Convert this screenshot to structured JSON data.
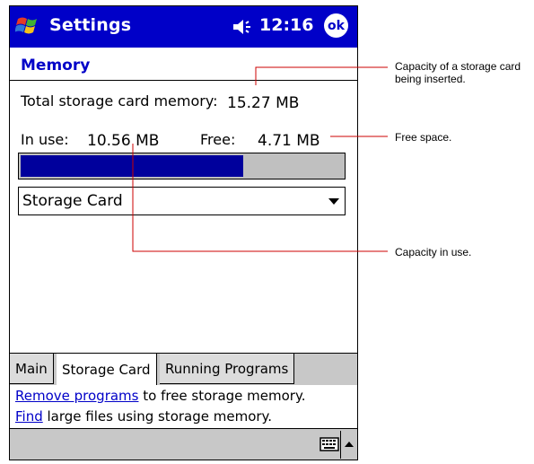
{
  "titlebar": {
    "app_title": "Settings",
    "time": "12:16",
    "ok_label": "ok",
    "accent_color": "#0000c8"
  },
  "page": {
    "title": "Memory"
  },
  "memory": {
    "total_label": "Total storage card memory:",
    "total_value": "15.27 MB",
    "in_use_label": "In use:",
    "in_use_value": "10.56 MB",
    "free_label": "Free:",
    "free_value": "4.71 MB",
    "usage_fraction": 0.69,
    "bar_color": "#00009c"
  },
  "storage_select": {
    "selected": "Storage Card"
  },
  "tabs": [
    {
      "label": "Main"
    },
    {
      "label": "Storage Card"
    },
    {
      "label": "Running Programs"
    }
  ],
  "links": {
    "line1_link": "Remove programs",
    "line1_rest": " to free storage memory.",
    "line2_link": "Find",
    "line2_rest": " large files using storage memory."
  },
  "callouts": {
    "capacity": "Capacity of a storage card being inserted.",
    "free_space": "Free space.",
    "in_use": "Capacity in use."
  },
  "icons": {
    "start": "windows-flag-icon",
    "speaker": "speaker-icon",
    "keyboard": "keyboard-icon",
    "sip_arrow": "up-arrow-icon"
  }
}
